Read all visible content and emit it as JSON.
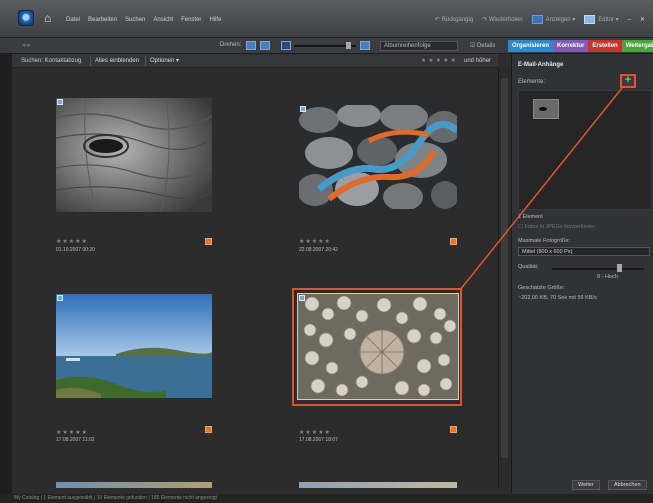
{
  "menubar": {
    "items": [
      "Datei",
      "Bearbeiten",
      "Suchen",
      "Ansicht",
      "Fenster",
      "Hilfe"
    ],
    "undo": "Rückgängig",
    "redo": "Wiederholen",
    "view_menu": "Anzeigen ▾",
    "editor_menu": "Editor ▾"
  },
  "toolbar": {
    "rotate_label": "Drehen:",
    "sort_value": "Albumreihenfolge",
    "details_label": "Details",
    "tabs": [
      {
        "label": "Organisieren",
        "color": "#2d89c9"
      },
      {
        "label": "Korrektur",
        "color": "#7e5bb3"
      },
      {
        "label": "Erstellen",
        "color": "#c9332d"
      },
      {
        "label": "Weitergabe",
        "color": "#49a43a"
      }
    ]
  },
  "searchbar": {
    "label": "Suchen: Kontaktabzug",
    "show_all": "Alles einblenden",
    "options": "Optionen ▾",
    "rating_stars": "★★★★★",
    "and_higher": "und höher"
  },
  "photos": [
    {
      "stars": "★★★★★",
      "date": "01.10.2007 00:20"
    },
    {
      "stars": "★★★★★",
      "date": "22.09.2007 20:42"
    },
    {
      "stars": "★★★★★",
      "date": "17.08.2007 11:02"
    },
    {
      "stars": "★★★★★",
      "date": "17.08.2007 18:07"
    }
  ],
  "panel": {
    "title": "E-Mail-Anhänge",
    "elements_label": "Elemente:",
    "add_icon": "+",
    "count_label": "1 Element",
    "convert_label": "Fotos in JPEGs konvertieren",
    "max_size_label": "Maximale Fotogröße:",
    "max_size_value": "Mittel (800 x 600 Px)",
    "quality_label": "Qualität:",
    "quality_value": "9 - Hoch",
    "est_size_label": "Geschätzte Größe:",
    "est_size_value": "~202,00  KB, 70 Sek mit 56 KB/s",
    "next_button": "Weiter",
    "cancel_button": "Abbrechen"
  },
  "status": "My Catalog  |  1 Element ausgewählt  |  10 Elemente gefunden  |  185 Elemente nicht angezeigt",
  "colors": {
    "highlight": "#e0532c",
    "accent": "#2d89c9"
  }
}
